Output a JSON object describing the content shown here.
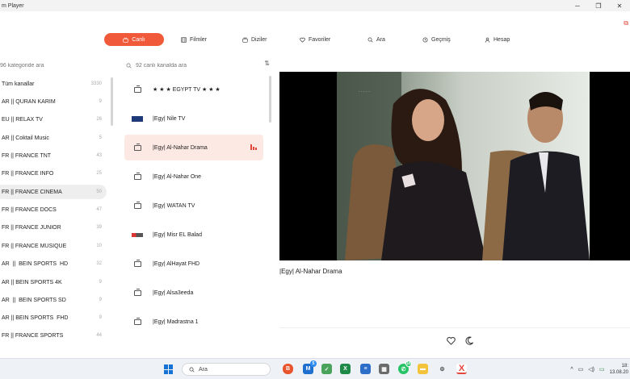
{
  "window": {
    "title": "m Player",
    "controls": [
      "─",
      "❐",
      "✕"
    ]
  },
  "nav": {
    "items": [
      {
        "label": "Canlı",
        "icon": "tv-icon"
      },
      {
        "label": "Filmler",
        "icon": "film-icon"
      },
      {
        "label": "Diziler",
        "icon": "series-icon"
      },
      {
        "label": "Favoriler",
        "icon": "heart-icon"
      },
      {
        "label": "Ara",
        "icon": "search-icon"
      },
      {
        "label": "Geçmiş",
        "icon": "history-icon"
      },
      {
        "label": "Hesap",
        "icon": "user-icon"
      }
    ],
    "active_index": 0
  },
  "categories": {
    "search_placeholder": "96 kategoride ara",
    "items": [
      {
        "name": "Tüm kanallar",
        "count": "3330"
      },
      {
        "name": "AR || QURAN KARIM",
        "count": "9"
      },
      {
        "name": "EU || RELAX TV",
        "count": "26"
      },
      {
        "name": "AR || Coktail Music",
        "count": "5"
      },
      {
        "name": "FR || FRANCE TNT",
        "count": "43"
      },
      {
        "name": "FR || FRANCE INFO",
        "count": "25"
      },
      {
        "name": "FR || FRANCE CINEMA",
        "count": "50"
      },
      {
        "name": "FR || FRANCE DOCS",
        "count": "47"
      },
      {
        "name": "FR || FRANCE JUNIOR",
        "count": "39"
      },
      {
        "name": "FR || FRANCE MUSIQUE",
        "count": "10"
      },
      {
        "name": "AR  ||  BEIN SPORTS  HD",
        "count": "32"
      },
      {
        "name": "AR || BEIN SPORTS 4K",
        "count": "9"
      },
      {
        "name": "AR  ||  BEIN SPORTS SD",
        "count": "9"
      },
      {
        "name": "AR || BEIN SPORTS  FHD",
        "count": "9"
      },
      {
        "name": "FR || FRANCE SPORTS",
        "count": "44"
      }
    ],
    "active_index": 6
  },
  "channels": {
    "search_placeholder": "92 canlı kanalda ara",
    "items": [
      {
        "name": "★ ★ ★ EGYPT TV ★ ★ ★",
        "logo": "tv-icon"
      },
      {
        "name": "|Egy| Nile TV",
        "logo": "nile-logo"
      },
      {
        "name": "|Egy| Al-Nahar Drama",
        "logo": "tv-icon"
      },
      {
        "name": "|Egy| Al-Nahar One",
        "logo": "tv-icon"
      },
      {
        "name": "|Egy| WATAN TV",
        "logo": "tv-icon"
      },
      {
        "name": "|Egy| Misr EL Balad",
        "logo": "misr-logo"
      },
      {
        "name": "|Egy| AlHayat FHD",
        "logo": "tv-icon"
      },
      {
        "name": "|Egy| Alsa3eeda",
        "logo": "tv-icon"
      },
      {
        "name": "|Egy| Madrastna 1",
        "logo": "tv-icon"
      }
    ],
    "active_index": 2
  },
  "player": {
    "now_playing": "|Egy| Al-Nahar Drama"
  },
  "taskbar": {
    "search_label": "Ara",
    "badges": {
      "mail": "5",
      "whatsapp": "18"
    },
    "time": "18:",
    "date": "13.08.20"
  },
  "colors": {
    "accent": "#f05a3a",
    "active_row": "#fde9e4",
    "category_active": "#eeeeee"
  }
}
